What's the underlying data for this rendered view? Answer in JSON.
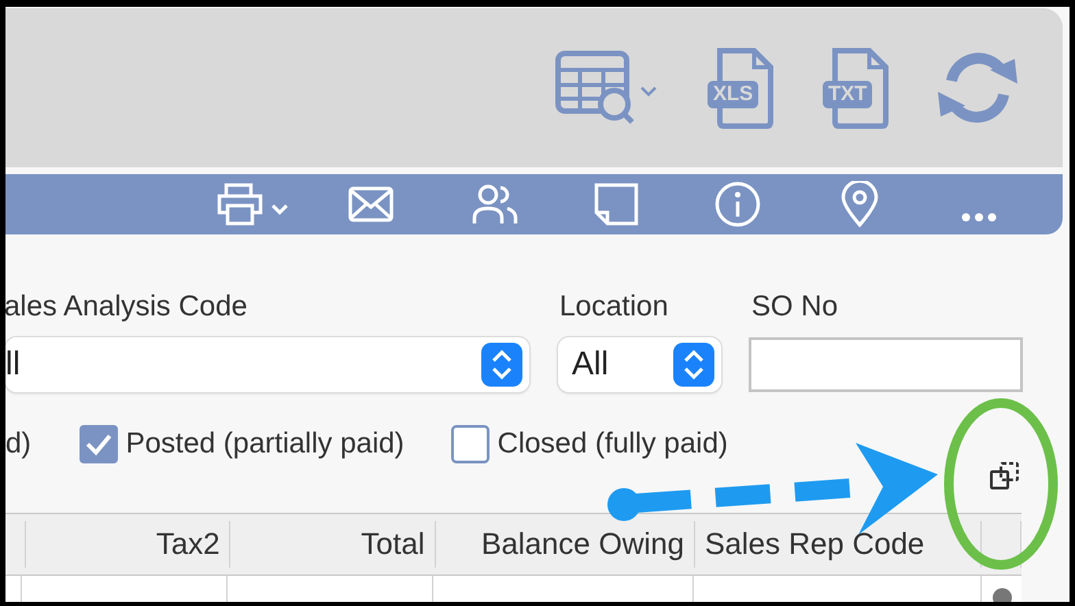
{
  "toolbar": {
    "export_buttons": [
      {
        "label": "XLS"
      },
      {
        "label": "TXT"
      }
    ]
  },
  "filters": {
    "sales_analysis_code": {
      "label": "ales Analysis Code",
      "value": "ll"
    },
    "location": {
      "label": "Location",
      "value": "All"
    },
    "so_no": {
      "label": "SO No"
    }
  },
  "status_options": {
    "cut_text": "d)",
    "options": [
      {
        "label": "Posted (partially paid)",
        "checked": true
      },
      {
        "label": "Closed (fully paid)",
        "checked": false
      }
    ]
  },
  "table": {
    "columns": [
      "Tax2",
      "Total",
      "Balance Owing",
      "Sales Rep Code"
    ]
  }
}
